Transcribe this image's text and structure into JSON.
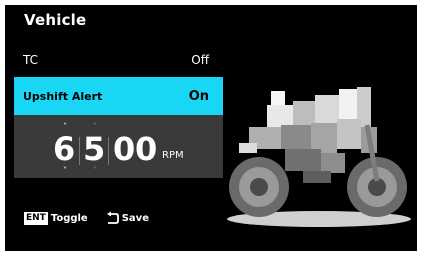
{
  "header": {
    "title": "Vehicle"
  },
  "settings": [
    {
      "label": "TC",
      "value": "Off"
    },
    {
      "label": "Upshift Alert",
      "value": "On"
    }
  ],
  "rpm_editor": {
    "digits": [
      "6",
      "5",
      "0",
      "0"
    ],
    "unit": "RPM"
  },
  "footer": {
    "enter_key": "ENT",
    "enter_action": "Toggle",
    "back_action": "Save"
  },
  "colors": {
    "background": "#000000",
    "highlight": "#19d6f5",
    "panel": "#3a3a3a"
  },
  "icons": [
    "up-arrow-icon",
    "down-arrow-icon",
    "back-arrow-icon",
    "motorcycle-image"
  ]
}
